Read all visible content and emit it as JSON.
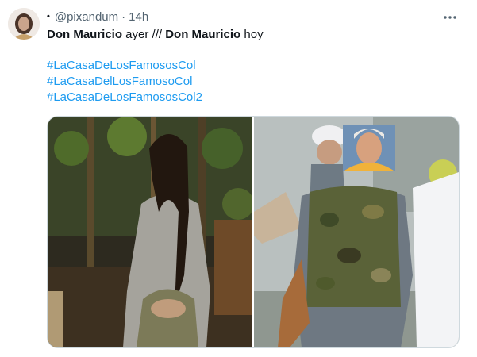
{
  "tweet": {
    "display_name_glyph": "•",
    "handle": "@pixandum",
    "separator": "·",
    "time": "14h",
    "more_icon": "more-horizontal-icon",
    "text_line1": {
      "part1": "Don Mauricio",
      "part2": " ayer /// ",
      "part3": "Don Mauricio",
      "part4": " hoy"
    },
    "hashtags": [
      "#LaCasaDeLosFamososCol",
      "#LaCasaDelLosFamosoCol",
      "#LaCasaDeLosFamososCol2"
    ]
  },
  "media": {
    "left_image": "photo-woman-hostage-in-jungle",
    "right_image": "photo-man-in-camouflage-vest-with-face-overlay"
  },
  "colors": {
    "link": "#1d9bf0",
    "text": "#0f1419",
    "secondary": "#536471"
  }
}
